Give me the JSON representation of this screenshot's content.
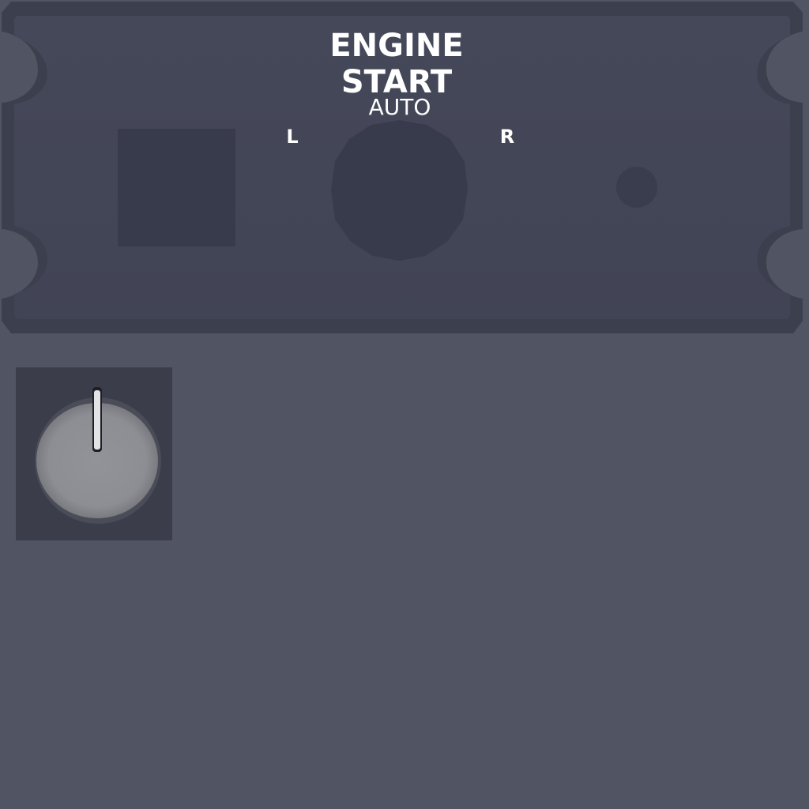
{
  "panel": {
    "title_line1": "ENGINE",
    "title_line2": "START",
    "subtitle": "AUTO",
    "left_label": "L",
    "right_label": "R"
  },
  "knob": {
    "pointer_position": "up"
  },
  "colors": {
    "background": "#515463",
    "panel_face": "#434656",
    "panel_edge": "#3c3f4e",
    "recess": "#383b4c",
    "knob_box": "#3b3d4b",
    "knob": "#8c8d92",
    "label_text": "#ffffff"
  },
  "icons": {
    "selector": "engine-start-selector-icon",
    "indicator": "indicator-light-icon",
    "knob": "rotary-knob-icon"
  }
}
